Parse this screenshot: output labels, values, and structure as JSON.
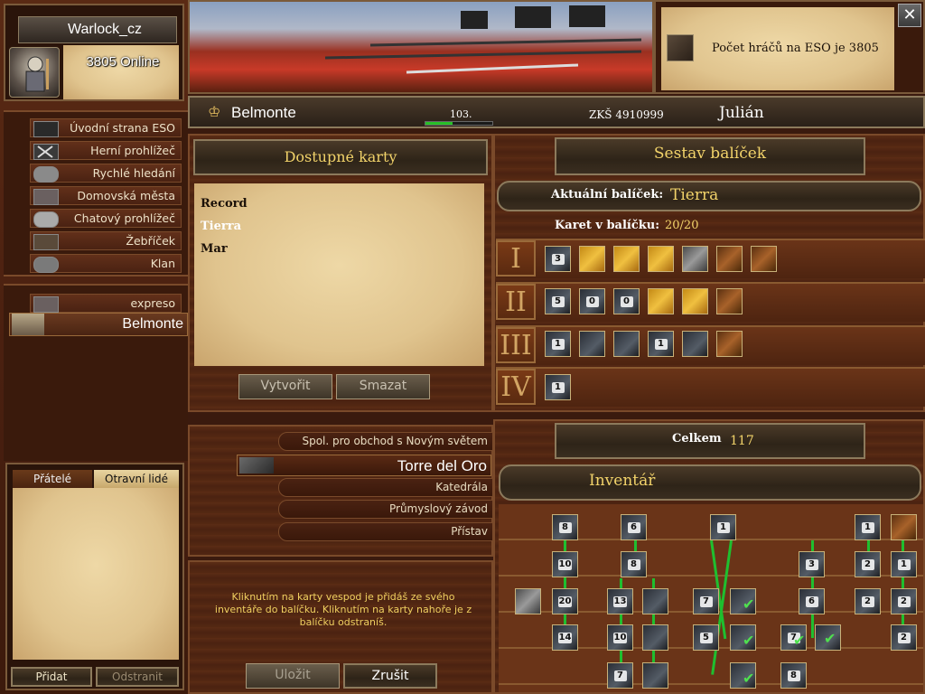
{
  "player": {
    "name": "Warlock_cz",
    "online": "3805 Online"
  },
  "news": {
    "text": "Počet hráčů na ESO je 3805"
  },
  "topbar": {
    "city": "Belmonte",
    "level": "103.",
    "xp": "ZKŠ 4910999",
    "hero": "Julián"
  },
  "menu": [
    {
      "label": "Úvodní strana ESO",
      "icon": "eso-icon"
    },
    {
      "label": "Herní prohlížeč",
      "icon": "swords-icon"
    },
    {
      "label": "Rychlé hledání",
      "icon": "search-icon"
    },
    {
      "label": "Domovská města",
      "icon": "city-icon"
    },
    {
      "label": "Chatový prohlížeč",
      "icon": "chat-icon"
    },
    {
      "label": "Žebříček",
      "icon": "ladder-icon"
    },
    {
      "label": "Klan",
      "icon": "clan-icon"
    }
  ],
  "cities": [
    {
      "label": "expreso"
    },
    {
      "label": "Belmonte"
    }
  ],
  "friends": {
    "tab_friends": "Přátelé",
    "tab_ignored": "Otravní lidé",
    "add": "Přidat",
    "remove": "Odstranit"
  },
  "decks": {
    "title": "Dostupné karty",
    "items": [
      "Record",
      "Tierra",
      "Mar"
    ],
    "create": "Vytvořit",
    "delete": "Smazat"
  },
  "builder": {
    "title": "Sestav balíček",
    "current_label": "Aktuální balíček:",
    "current_value": "Tierra",
    "count_label": "Karet v balíčku:",
    "count_value": "20/20",
    "ages": [
      "I",
      "II",
      "III",
      "IV"
    ],
    "age_cards": [
      [
        {
          "style": "c-dark",
          "n": "3"
        },
        {
          "style": "c-gold",
          "n": ""
        },
        {
          "style": "c-gold",
          "n": ""
        },
        {
          "style": "c-gold",
          "n": ""
        },
        {
          "style": "c-grey",
          "n": ""
        },
        {
          "style": "c-brown",
          "n": ""
        },
        {
          "style": "c-brown",
          "n": ""
        }
      ],
      [
        {
          "style": "c-dark",
          "n": "5"
        },
        {
          "style": "c-dark",
          "n": "0"
        },
        {
          "style": "c-dark",
          "n": "0"
        },
        {
          "style": "c-gold",
          "n": ""
        },
        {
          "style": "c-gold",
          "n": ""
        },
        {
          "style": "c-brown",
          "n": ""
        }
      ],
      [
        {
          "style": "c-dark",
          "n": "1"
        },
        {
          "style": "c-dark",
          "n": ""
        },
        {
          "style": "c-dark",
          "n": ""
        },
        {
          "style": "c-dark",
          "n": "1"
        },
        {
          "style": "c-dark",
          "n": ""
        },
        {
          "style": "c-brown",
          "n": ""
        }
      ],
      [
        {
          "style": "c-dark",
          "n": "1"
        }
      ]
    ]
  },
  "buildings": {
    "items": [
      "Spol. pro obchod s Novým světem",
      "Torre del Oro",
      "Katedrála",
      "Průmyslový závod",
      "Přístav"
    ]
  },
  "inventory": {
    "total_label": "Celkem",
    "total_value": "117",
    "title": "Inventář",
    "cards": [
      {
        "n": "8",
        "col": 0,
        "row": 0
      },
      {
        "n": "10",
        "col": 0,
        "row": 1
      },
      {
        "n": "20",
        "col": 0,
        "row": 2
      },
      {
        "n": "14",
        "col": 0,
        "row": 3
      },
      {
        "n": "6",
        "col": 1,
        "row": 0
      },
      {
        "n": "8",
        "col": 1,
        "row": 1
      },
      {
        "n": "13",
        "col": 1,
        "row": 2
      },
      {
        "n": "10",
        "col": 1,
        "row": 3
      },
      {
        "n": "7",
        "col": 1,
        "row": 4
      },
      {
        "n": "",
        "col": 2,
        "row": 2
      },
      {
        "n": "",
        "col": 2,
        "row": 3
      },
      {
        "n": "",
        "col": 2,
        "row": 4
      },
      {
        "n": "1",
        "col": 3,
        "row": 0
      },
      {
        "n": "7",
        "col": 3,
        "row": 2
      },
      {
        "n": "5",
        "col": 3,
        "row": 3
      },
      {
        "n": "3",
        "col": 4,
        "row": 1
      },
      {
        "n": "6",
        "col": 4,
        "row": 2
      },
      {
        "n": "7",
        "col": 4,
        "row": 3
      },
      {
        "n": "8",
        "col": 4,
        "row": 4
      },
      {
        "n": "1",
        "col": 5,
        "row": 0
      },
      {
        "n": "2",
        "col": 5,
        "row": 1
      },
      {
        "n": "2",
        "col": 5,
        "row": 2
      },
      {
        "n": "1",
        "col": 6,
        "row": 1
      },
      {
        "n": "2",
        "col": 6,
        "row": 2
      },
      {
        "n": "2",
        "col": 6,
        "row": 3
      }
    ]
  },
  "instructions": "Kliknutím na karty vespod je přidáš ze svého inventáře do balíčku. Kliknutím na karty nahoře je z balíčku odstraníš.",
  "actions": {
    "save": "Uložit",
    "cancel": "Zrušit"
  },
  "colors": {
    "accent_gold": "#f2d36a",
    "check_green": "#4fe04f",
    "line_green": "#1fbf2f"
  }
}
